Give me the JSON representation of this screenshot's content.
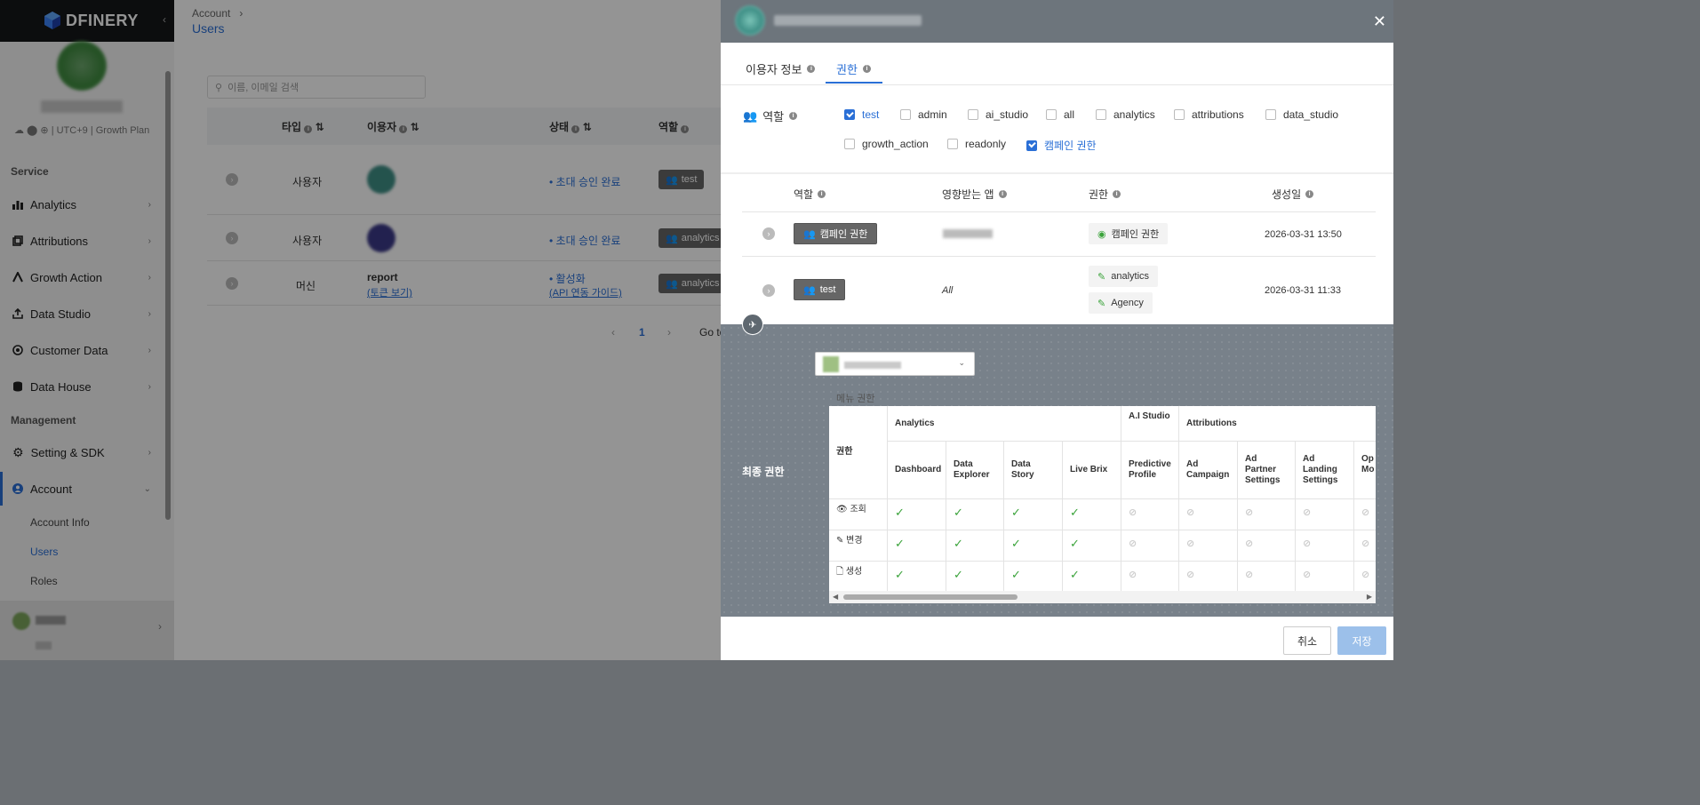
{
  "sidebar": {
    "logo_text": "DFINERY",
    "org_meta": "UTC+9 | Growth Plan",
    "sections": {
      "service": "Service",
      "management": "Management"
    },
    "nav": [
      "Analytics",
      "Attributions",
      "Growth Action",
      "Data Studio",
      "Customer Data",
      "Data House",
      "Setting & SDK",
      "Account"
    ],
    "account_sub": [
      "Account Info",
      "Users",
      "Roles"
    ]
  },
  "main": {
    "breadcrumb": "Account",
    "title": "Users",
    "search_placeholder": "이름, 이메일 검색",
    "columns": [
      "타입",
      "이용자",
      "상태",
      "역할"
    ],
    "rows": [
      {
        "type": "사용자",
        "status": "초대 승인 완료",
        "role": "test"
      },
      {
        "type": "사용자",
        "status": "초대 승인 완료",
        "role": "analytics"
      },
      {
        "type": "머신",
        "user": "report",
        "user_link": "(토큰 보기)",
        "status": "활성화",
        "status_link": "(API 연동 가이드)",
        "role": "analytics"
      }
    ],
    "pager": {
      "current": "1",
      "goto": "Go to"
    }
  },
  "modal": {
    "tabs": [
      "이용자 정보",
      "권한"
    ],
    "role_label": "역할",
    "roles": [
      {
        "name": "test",
        "checked": true
      },
      {
        "name": "admin",
        "checked": false
      },
      {
        "name": "ai_studio",
        "checked": false
      },
      {
        "name": "all",
        "checked": false
      },
      {
        "name": "analytics",
        "checked": false
      },
      {
        "name": "attributions",
        "checked": false
      },
      {
        "name": "data_studio",
        "checked": false
      },
      {
        "name": "growth_action",
        "checked": false
      },
      {
        "name": "readonly",
        "checked": false
      },
      {
        "name": "캠페인 권한",
        "checked": true
      }
    ],
    "grant_headers": [
      "역할",
      "영향받는 앱",
      "권한",
      "생성일"
    ],
    "grants": [
      {
        "role": "캠페인 권한",
        "app": "",
        "perms": [
          "캠페인 권한"
        ],
        "date": "2026-03-31 13:50"
      },
      {
        "role": "test",
        "app": "All",
        "perms": [
          "analytics",
          "Agency"
        ],
        "date": "2026-03-31 11:33"
      }
    ],
    "final": {
      "title": "최종 권한",
      "menu_label": "메뉴 권한",
      "row_header": "권한",
      "groups": [
        "Analytics",
        "A.I Studio",
        "Attributions"
      ],
      "columns": [
        "Dashboard",
        "Data Explorer",
        "Data Story",
        "Live Brix",
        "Predictive Profile",
        "Ad Campaign",
        "Ad Partner Settings",
        "Ad Landing Settings",
        "Op Att Mo"
      ],
      "actions": [
        "조회",
        "변경",
        "생성"
      ],
      "matrix": [
        [
          true,
          true,
          true,
          true,
          false,
          false,
          false,
          false,
          false
        ],
        [
          true,
          true,
          true,
          true,
          false,
          false,
          false,
          false,
          false
        ],
        [
          true,
          true,
          true,
          true,
          false,
          false,
          false,
          false,
          false
        ]
      ]
    },
    "buttons": {
      "cancel": "취소",
      "save": "저장"
    }
  },
  "colors": {
    "accent": "#2a6fd6",
    "check_green": "#3aa33a",
    "header_gray": "#6d757c"
  }
}
